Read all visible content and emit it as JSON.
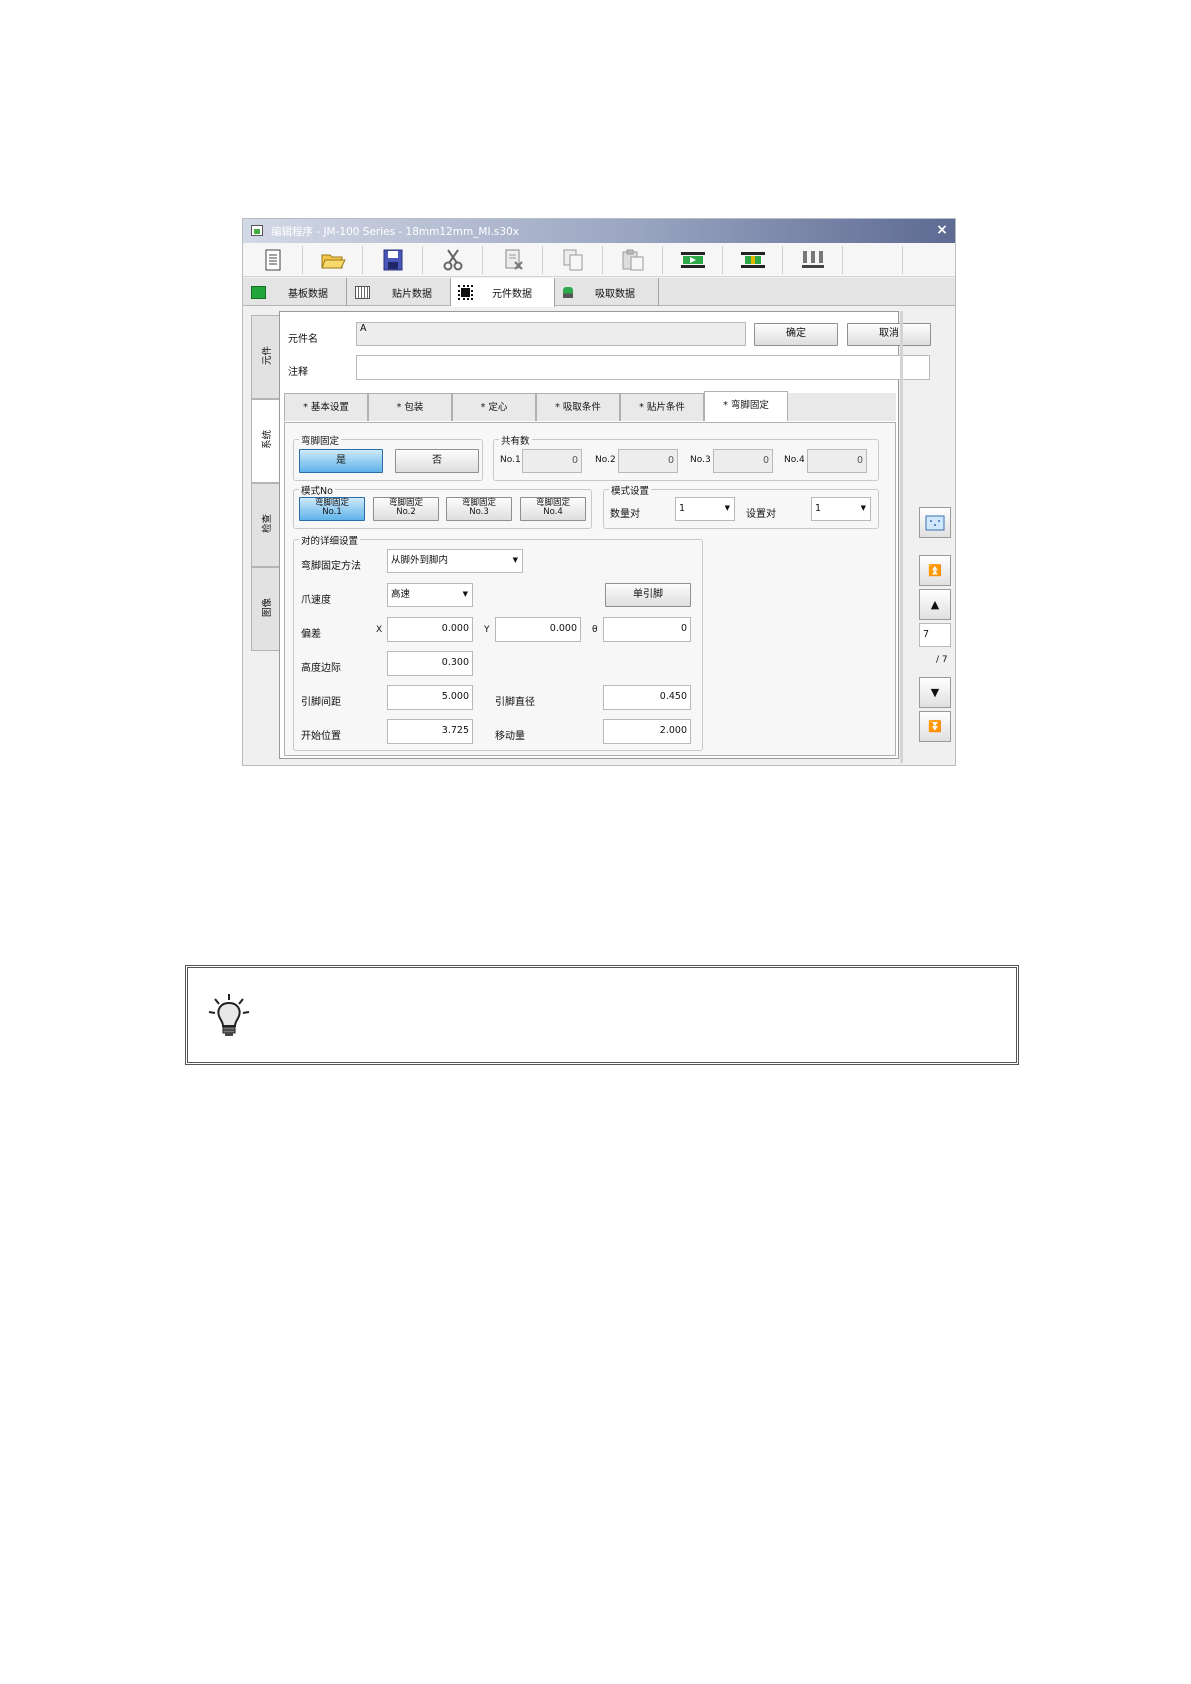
{
  "window": {
    "title": "编辑程序 - JM-100 Series - 18mm12mm_MI.s30x",
    "close_glyph": "×"
  },
  "toolbar": {
    "icons": [
      "new-file-icon",
      "open-folder-icon",
      "save-icon",
      "cut-icon",
      "delete-icon",
      "copy-icon",
      "paste-icon",
      "conveyor-in-icon",
      "conveyor-icon",
      "nozzle-icon"
    ]
  },
  "top_tabs": [
    {
      "label": "基板数据",
      "icon": "board-icon"
    },
    {
      "label": "贴片数据",
      "icon": "grid-icon"
    },
    {
      "label": "元件数据",
      "icon": "chip-icon",
      "active": true
    },
    {
      "label": "吸取数据",
      "icon": "pickup-icon"
    }
  ],
  "side_tabs": [
    {
      "label": "元件"
    },
    {
      "label": "系统",
      "active": true
    },
    {
      "label": "检查"
    },
    {
      "label": "图像"
    }
  ],
  "form": {
    "part_name_label": "元件名",
    "part_name_value": "A",
    "comment_label": "注释",
    "comment_value": "",
    "ok_label": "确定",
    "cancel_label": "取消"
  },
  "inner_tabs": [
    {
      "label": "* 基本设置"
    },
    {
      "label": "* 包装"
    },
    {
      "label": "* 定心"
    },
    {
      "label": "* 吸取条件"
    },
    {
      "label": "* 贴片条件"
    },
    {
      "label": "* 弯脚固定",
      "active": true
    }
  ],
  "clinch": {
    "group_title": "弯脚固定",
    "yes_label": "是",
    "no_label": "否",
    "yes_selected": true
  },
  "shared": {
    "group_title": "共有数",
    "items": [
      {
        "label": "No.1",
        "value": "0"
      },
      {
        "label": "No.2",
        "value": "0"
      },
      {
        "label": "No.3",
        "value": "0"
      },
      {
        "label": "No.4",
        "value": "0"
      }
    ]
  },
  "pattern": {
    "group_title": "模式No",
    "buttons": [
      {
        "line1": "弯脚固定",
        "line2": "No.1",
        "selected": true
      },
      {
        "line1": "弯脚固定",
        "line2": "No.2"
      },
      {
        "line1": "弯脚固定",
        "line2": "No.3"
      },
      {
        "line1": "弯脚固定",
        "line2": "No.4"
      }
    ]
  },
  "mode_settings": {
    "group_title": "模式设置",
    "count_label": "数量对",
    "count_value": "1",
    "set_label": "设置对",
    "set_value": "1"
  },
  "detail": {
    "group_title": "对的详细设置",
    "method_label": "弯脚固定方法",
    "method_value": "从脚外到脚内",
    "speed_label": "爪速度",
    "speed_value": "高速",
    "single_pin_label": "单引脚",
    "offset_label": "偏差",
    "x_label": "X",
    "x_value": "0.000",
    "y_label": "Y",
    "y_value": "0.000",
    "theta_label": "θ",
    "theta_value": "0",
    "height_label": "高度边际",
    "height_value": "0.300",
    "pitch_label": "引脚间距",
    "pitch_value": "5.000",
    "diameter_label": "引脚直径",
    "diameter_value": "0.450",
    "start_label": "开始位置",
    "start_value": "3.725",
    "move_label": "移动量",
    "move_value": "2.000"
  },
  "nav": {
    "page_value": "7",
    "page_total": "/ 7",
    "first_glyph": "⏫",
    "prev_glyph": "▲",
    "next_glyph": "▼",
    "last_glyph": "⏬"
  }
}
